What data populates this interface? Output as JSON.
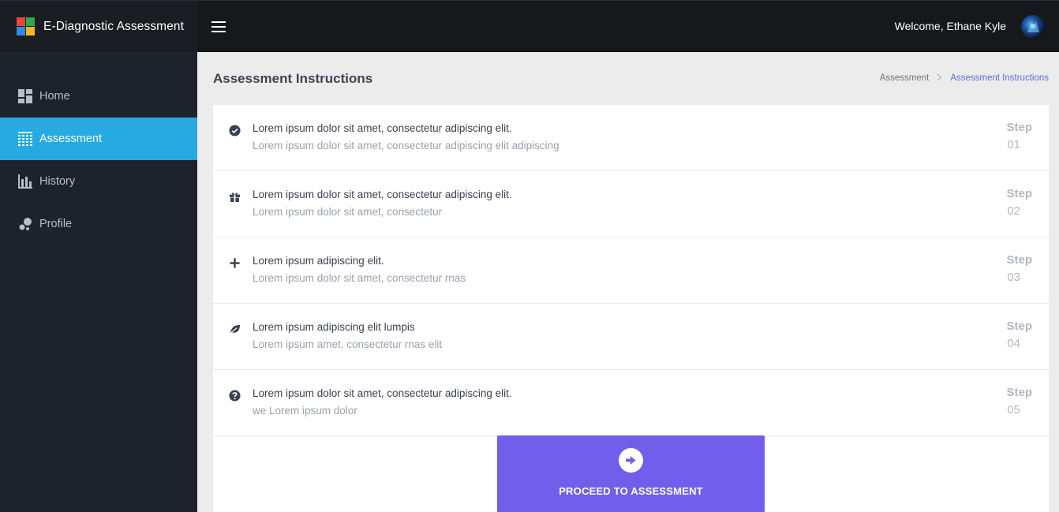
{
  "app": {
    "title": "E-Diagnostic Assessment",
    "logo_colors": [
      "#e8473a",
      "#2fa84f",
      "#2f8be8",
      "#f5b81d"
    ]
  },
  "sidebar": {
    "items": [
      {
        "label": "Home",
        "icon": "dashboard-icon",
        "active": false
      },
      {
        "label": "Assessment",
        "icon": "table-icon",
        "active": true
      },
      {
        "label": "History",
        "icon": "bar-chart-icon",
        "active": false
      },
      {
        "label": "Profile",
        "icon": "profile-bubbles-icon",
        "active": false
      }
    ]
  },
  "header": {
    "welcome": "Welcome, Ethane Kyle",
    "menu_icon": "hamburger-icon",
    "avatar_icon": "avatar"
  },
  "page": {
    "title": "Assessment Instructions",
    "breadcrumb": [
      "Assessment",
      "Assessment Instructions"
    ],
    "breadcrumb_separator": ">"
  },
  "steps": [
    {
      "icon": "check-circle-icon",
      "title": "Lorem ipsum dolor sit amet, consectetur adipiscing elit.",
      "subtitle": "Lorem ipsum dolor sit amet, consectetur adipiscing elit adipiscing",
      "label": "Step",
      "number": "01"
    },
    {
      "icon": "gift-icon",
      "title": "Lorem ipsum dolor sit amet, consectetur adipiscing elit.",
      "subtitle": "Lorem ipsum dolor sit amet, consectetur",
      "label": "Step",
      "number": "02"
    },
    {
      "icon": "plus-icon",
      "title": "Lorem ipsum adipiscing elit.",
      "subtitle": "Lorem ipsum dolor sit amet, consectetur rnas",
      "label": "Step",
      "number": "03"
    },
    {
      "icon": "leaf-icon",
      "title": "Lorem ipsum adipiscing elit lumpis",
      "subtitle": "Lorem ipsum amet, consectetur rnas elit",
      "label": "Step",
      "number": "04"
    },
    {
      "icon": "question-circle-icon",
      "title": "Lorem ipsum dolor sit amet, consectetur adipiscing elit.",
      "subtitle": "we Lorem ipsum dolor",
      "label": "Step",
      "number": "05"
    }
  ],
  "proceed": {
    "label": "PROCEED TO ASSESSMENT",
    "icon": "arrow-right-circle-icon",
    "color": "#715fec"
  },
  "colors": {
    "sidebar_bg": "#1e232b",
    "topbar_bg": "#16181b",
    "active_nav": "#27aae1",
    "content_bg": "#ececec",
    "breadcrumb_active": "#5b6be0"
  }
}
